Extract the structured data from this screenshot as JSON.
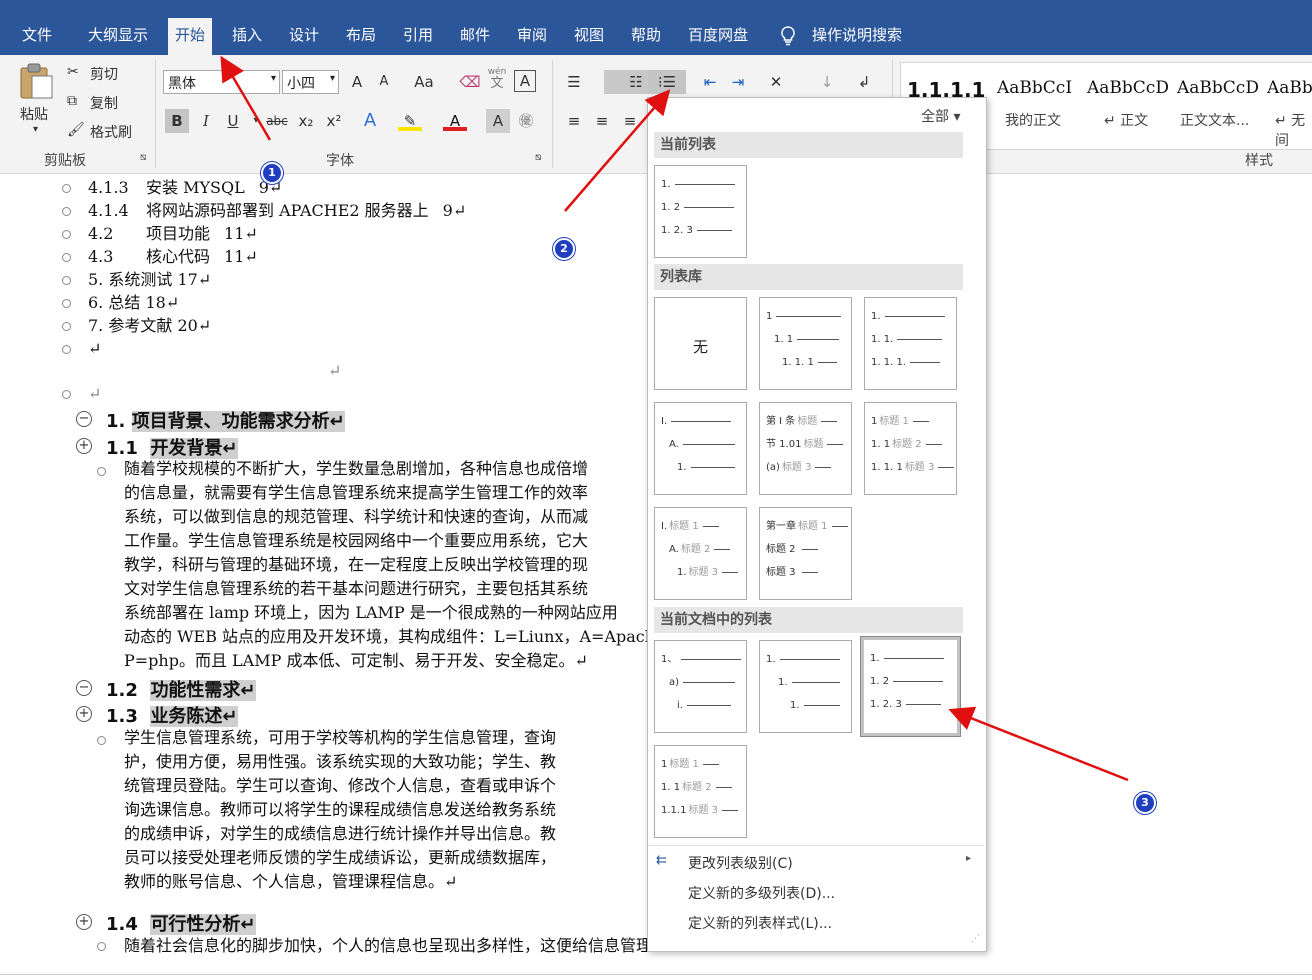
{
  "tabs": [
    "文件",
    "大纲显示",
    "开始",
    "插入",
    "设计",
    "布局",
    "引用",
    "邮件",
    "审阅",
    "视图",
    "帮助",
    "百度网盘"
  ],
  "search_label": "操作说明搜索",
  "clipboard": {
    "paste": "粘贴",
    "cut": "剪切",
    "copy": "复制",
    "format_painter": "格式刷",
    "group": "剪贴板"
  },
  "font": {
    "name": "黑体",
    "size": "小四",
    "group": "字体",
    "aa": "Aa",
    "grow": "A",
    "shrink": "A",
    "bold": "B",
    "italic": "I",
    "underline": "U",
    "strike": "abc",
    "sub": "x₂",
    "sup": "x²",
    "wen": "wén",
    "wen_char": "文",
    "font_a": "A"
  },
  "styles": {
    "group": "样式",
    "items": [
      {
        "preview": "1.1.1.1",
        "name": ""
      },
      {
        "preview": "AaBbCcI",
        "name": "我的正文"
      },
      {
        "preview": "AaBbCcD",
        "name": "↵ 正文"
      },
      {
        "preview": "AaBbCcD",
        "name": "正文文本..."
      },
      {
        "preview": "AaBbC",
        "name": "↵ 无间"
      }
    ]
  },
  "toc": [
    {
      "num": "4.1.3",
      "text": "安装 MYSQL",
      "page": "9↵"
    },
    {
      "num": "4.1.4",
      "text": "将网站源码部署到 APACHE2 服务器上",
      "page": "9↵"
    },
    {
      "num": "4.2",
      "text": "项目功能",
      "page": "11↵"
    },
    {
      "num": "4.3",
      "text": "核心代码",
      "page": "11↵"
    },
    {
      "num": "",
      "text": "5. 系统测试 17↵",
      "page": ""
    },
    {
      "num": "",
      "text": "6. 总结 18↵",
      "page": ""
    },
    {
      "num": "",
      "text": "7. 参考文献 20↵",
      "page": ""
    },
    {
      "num": "",
      "text": "↵",
      "page": ""
    }
  ],
  "empty_mark": "↵",
  "headings": {
    "h1": {
      "num": "1.",
      "text": "项目背景、功能需求分析↵"
    },
    "h11": {
      "num": "1.1",
      "text": "开发背景↵"
    },
    "h12": {
      "num": "1.2",
      "text": "功能性需求↵"
    },
    "h13": {
      "num": "1.3",
      "text": "业务陈述↵"
    },
    "h14": {
      "num": "1.4",
      "text": "可行性分析↵"
    }
  },
  "para1": [
    "随着学校规模的不断扩大，学生数量急剧增加，各种信息也成倍增",
    "的信息量，就需要有学生信息管理系统来提高学生管理工作的效率",
    "系统，可以做到信息的规范管理、科学统计和快速的查询，从而减",
    "工作量。学生信息管理系统是校园网络中一个重要应用系统，它大",
    "教学，科研与管理的基础环境，在一定程度上反映出学校管理的现",
    "文对学生信息管理系统的若干基本问题进行研究，主要包括其系统",
    "系统部署在 lamp 环境上，因为 LAMP 是一个很成熟的一种网站应用",
    "动态的 WEB 站点的应用及开发环境，其构成组件：L=Liunx，A=Apach",
    "P=php。而且 LAMP 成本低、可定制、易于开发、安全稳定。↵"
  ],
  "para2": [
    "学生信息管理系统，可用于学校等机构的学生信息管理，查询",
    "护，使用方便，易用性强。该系统实现的大致功能；学生、教",
    "统管理员登陆。学生可以查询、修改个人信息，查看或申诉个",
    "询选课信息。教师可以将学生的课程成绩信息发送给教务系统",
    "的成绩申诉，对学生的成绩信息进行统计操作并导出信息。教",
    "员可以接受处理老师反馈的学生成绩诉讼，更新成绩数据库，",
    "教师的账号信息、个人信息，管理课程信息。↵"
  ],
  "para3": "随着社会信息化的脚步加快，个人的信息也呈现出多样性，这便给信息管理",
  "dropdown": {
    "filter": "全部 ▾",
    "sec_current": "当前列表",
    "sec_library": "列表库",
    "sec_doc": "当前文档中的列表",
    "none": "无",
    "current_tile": [
      "1.",
      "1. 2",
      "1. 2. 3"
    ],
    "lib_t1": [
      "1",
      "1. 1",
      "1. 1. 1"
    ],
    "lib_t2": [
      "1.",
      "1. 1.",
      "1. 1. 1."
    ],
    "lib_t3": [
      "I.",
      "A.",
      "1."
    ],
    "lib_t4": [
      "第 I 条",
      "节 1.01",
      "(a)"
    ],
    "lib_t4_suffix": [
      "标题",
      "标题",
      "标题 3"
    ],
    "lib_t5": [
      "1",
      "1. 1",
      "1. 1. 1"
    ],
    "lib_t5_suffix": [
      "标题 1",
      "标题 2",
      "标题 3"
    ],
    "lib_t6": [
      "I.",
      "A.",
      "1."
    ],
    "lib_t6_suffix": [
      "标题 1",
      "标题 2",
      "标题 3"
    ],
    "lib_t7": [
      "第一章",
      "标题 2",
      "标题 3"
    ],
    "lib_t7_suffix": [
      "标题 1",
      "",
      ""
    ],
    "doc_t1": [
      "1、",
      "a)",
      "i."
    ],
    "doc_t2": [
      "1.",
      "1.",
      "1."
    ],
    "doc_t3": [
      "1.",
      "1. 2",
      "1. 2. 3"
    ],
    "doc_t4": [
      "1",
      "1. 1",
      "1.1.1"
    ],
    "doc_t4_suffix": [
      "标题 1",
      "标题 2",
      "标题 3"
    ],
    "change_level": "更改列表级别(C)",
    "define_multilevel": "定义新的多级列表(D)...",
    "define_style": "定义新的列表样式(L)..."
  },
  "badges": [
    "1",
    "2",
    "3"
  ]
}
